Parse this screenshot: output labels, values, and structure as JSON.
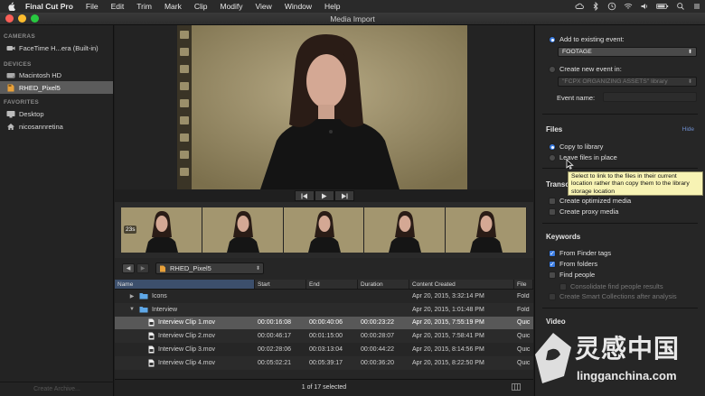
{
  "menubar": {
    "app_name": "Final Cut Pro",
    "items": [
      "File",
      "Edit",
      "Trim",
      "Mark",
      "Clip",
      "Modify",
      "View",
      "Window",
      "Help"
    ]
  },
  "window": {
    "title": "Media Import"
  },
  "sidebar": {
    "cameras_head": "CAMERAS",
    "cameras": [
      {
        "label": "FaceTime H...era (Built-in)"
      }
    ],
    "devices_head": "DEVICES",
    "devices": [
      {
        "label": "Macintosh HD"
      },
      {
        "label": "RHED_Pixel5"
      }
    ],
    "favorites_head": "FAVORITES",
    "favorites": [
      {
        "label": "Desktop"
      },
      {
        "label": "nicosannretina"
      }
    ],
    "create_archive": "Create Archive..."
  },
  "filmstrip": {
    "duration_badge": "23s"
  },
  "pathbar": {
    "location": "RHED_Pixel5"
  },
  "filelist": {
    "columns": [
      "Name",
      "Start",
      "End",
      "Duration",
      "Content Created",
      "File"
    ],
    "rows": [
      {
        "type": "folder",
        "name": "Icons",
        "start": "",
        "end": "",
        "duration": "",
        "created": "Apr 20, 2015, 3:32:14 PM",
        "file": "Fold"
      },
      {
        "type": "folder-open",
        "name": "Interview",
        "start": "",
        "end": "",
        "duration": "",
        "created": "Apr 20, 2015, 1:01:48 PM",
        "file": "Fold"
      },
      {
        "type": "file",
        "name": "Interview Clip 1.mov",
        "start": "00:00:16:08",
        "end": "00:00:40:06",
        "duration": "00:00:23:22",
        "created": "Apr 20, 2015, 7:55:19 PM",
        "file": "Quic",
        "selected": true
      },
      {
        "type": "file",
        "name": "Interview Clip 2.mov",
        "start": "00:00:46:17",
        "end": "00:01:15:00",
        "duration": "00:00:28:07",
        "created": "Apr 20, 2015, 7:58:41 PM",
        "file": "Quic"
      },
      {
        "type": "file",
        "name": "Interview Clip 3.mov",
        "start": "00:02:28:06",
        "end": "00:03:13:04",
        "duration": "00:00:44:22",
        "created": "Apr 20, 2015, 8:14:56 PM",
        "file": "Quic"
      },
      {
        "type": "file",
        "name": "Interview Clip 4.mov",
        "start": "00:05:02:21",
        "end": "00:05:39:17",
        "duration": "00:00:36:20",
        "created": "Apr 20, 2015, 8:22:50 PM",
        "file": "Quic"
      }
    ]
  },
  "status": {
    "selection": "1 of 17 selected"
  },
  "import_options": {
    "add_existing_label": "Add to existing event:",
    "existing_event": "FOOTAGE",
    "create_new_label": "Create new event in:",
    "new_event_library": "\"FCPX ORGANIZING ASSETS\" library",
    "event_name_label": "Event name:",
    "files_head": "Files",
    "hide_label": "Hide",
    "copy_label": "Copy to library",
    "leave_label": "Leave files in place",
    "tooltip": "Select to link to the files in their current location rather than copy them to the library storage location",
    "transcode_head": "Transc",
    "optimized_label": "Create optimized media",
    "proxy_label": "Create proxy media",
    "keywords_head": "Keywords",
    "finder_tags_label": "From Finder tags",
    "folders_label": "From folders",
    "find_people_label": "Find people",
    "consolidate_label": "Consolidate find people results",
    "smart_coll_label": "Create Smart Collections after analysis",
    "video_head": "Video"
  },
  "watermark": {
    "text": "灵感中国",
    "url": "lingganchina.com"
  },
  "colors": {
    "accent": "#3a7be0",
    "selection": "#585858",
    "tooltip": "#f7f3b4"
  }
}
